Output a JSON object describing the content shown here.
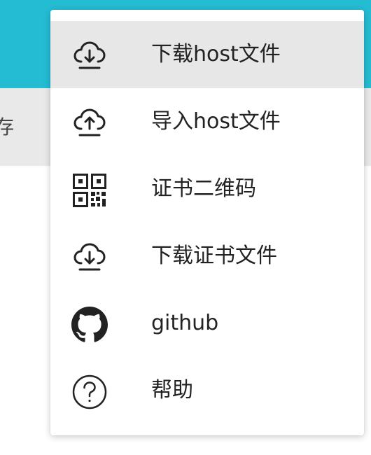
{
  "background": {
    "partial_text": "存",
    "colors": {
      "topbar": "#24bcd3",
      "subbar": "#e9e9e9"
    }
  },
  "menu": {
    "items": [
      {
        "label": "下载host文件",
        "icon": "cloud-download-icon",
        "active": true
      },
      {
        "label": "导入host文件",
        "icon": "cloud-upload-icon",
        "active": false
      },
      {
        "label": "证书二维码",
        "icon": "qr-code-icon",
        "active": false
      },
      {
        "label": "下载证书文件",
        "icon": "cloud-download-icon",
        "active": false
      },
      {
        "label": "github",
        "icon": "github-icon",
        "active": false
      },
      {
        "label": "帮助",
        "icon": "help-circle-icon",
        "active": false
      }
    ]
  }
}
